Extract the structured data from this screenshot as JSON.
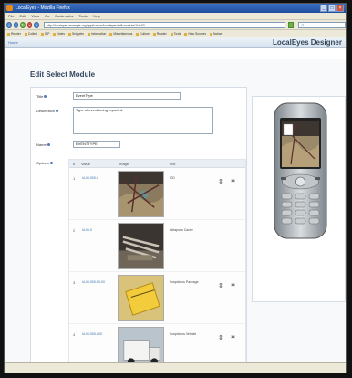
{
  "window": {
    "title": "LocalEyes - Mozilla Firefox"
  },
  "menu": [
    "File",
    "Edit",
    "View",
    "Go",
    "Bookmarks",
    "Tools",
    "Help"
  ],
  "nav": {
    "url": "http://localeyes.example.org/application/localeyes/edit-module/?id=63",
    "search": "G"
  },
  "bookmarks": [
    "Reader",
    "Collect",
    "IDP",
    "Notes",
    "Snippets",
    "Information",
    "Miscellaneous",
    "Culture",
    "Reader",
    "Tools",
    "New Sources",
    "Notice"
  ],
  "app": {
    "home_link": "Home",
    "brand": "LocalEyes Designer"
  },
  "page": {
    "heading": "Edit Select Module"
  },
  "form": {
    "title_label": "Title",
    "title_value": "EventType",
    "description_label": "Description",
    "description_value": "Type of event being reported.",
    "name_label": "Name",
    "name_value": "EVENTTYPE",
    "options_label": "Options"
  },
  "options_table": {
    "headers": [
      "#",
      "Value",
      "Image",
      "Text"
    ],
    "rows": [
      {
        "num": "1",
        "value": "id-00-000-0",
        "text": "IED"
      },
      {
        "num": "2",
        "value": "id-00-0",
        "text": "Weapons Cache"
      },
      {
        "num": "3",
        "value": "id-00-000-00-00",
        "text": "Suspicious Package"
      },
      {
        "num": "4",
        "value": "id-00-000-000",
        "text": "Suspicious Vehicle"
      }
    ]
  },
  "icons": {
    "move": "move-arrows-icon",
    "delete": "delete-x-icon"
  }
}
